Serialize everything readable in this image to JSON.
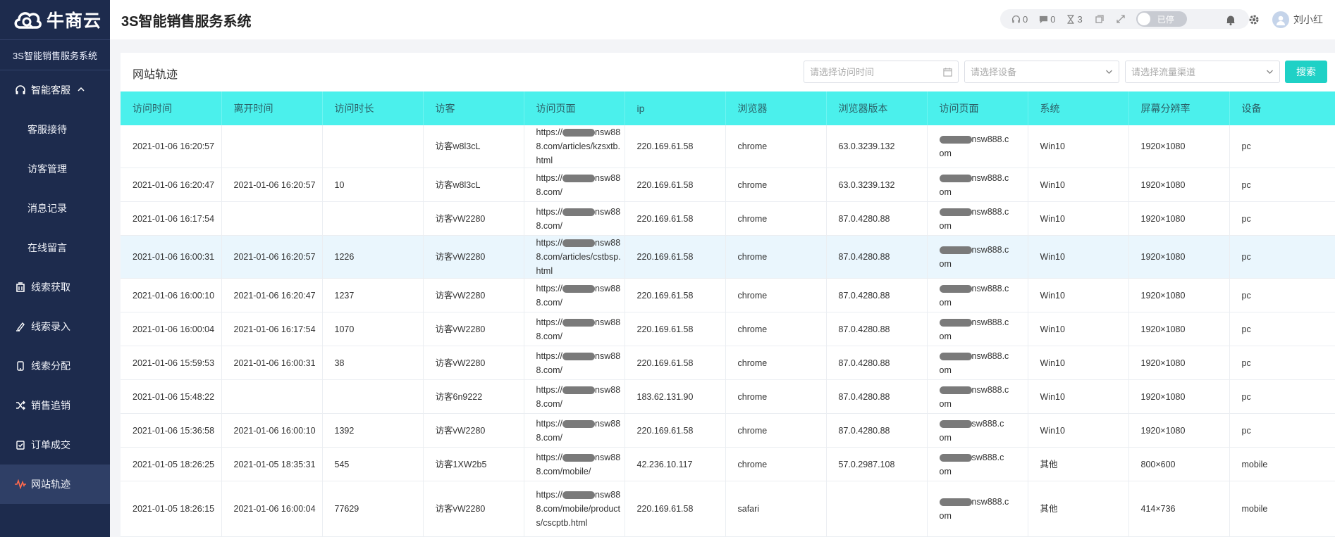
{
  "brand": {
    "logo_text": "牛商云",
    "system_name": "3S智能销售服务系统"
  },
  "sidebar": {
    "group": {
      "label": "智能客服"
    },
    "sub_items": [
      {
        "label": "客服接待"
      },
      {
        "label": "访客管理"
      },
      {
        "label": "消息记录"
      },
      {
        "label": "在线留言"
      }
    ],
    "items": [
      {
        "label": "线索获取",
        "icon": "building-icon"
      },
      {
        "label": "线索录入",
        "icon": "pen-icon"
      },
      {
        "label": "线索分配",
        "icon": "phone-icon"
      },
      {
        "label": "销售追销",
        "icon": "shuffle-icon"
      },
      {
        "label": "订单成交",
        "icon": "clipboard-icon"
      },
      {
        "label": "网站轨迹",
        "icon": "wave-icon",
        "active": true
      }
    ]
  },
  "header": {
    "title": "3S智能销售服务系统",
    "stats": {
      "headset": "0",
      "message": "0",
      "hourglass": "3"
    },
    "toggle_label": "已停",
    "user_name": "刘小红"
  },
  "panel": {
    "title": "网站轨迹",
    "filters": {
      "time_placeholder": "请选择访问时间",
      "device_placeholder": "请选择设备",
      "channel_placeholder": "请选择流量渠道"
    },
    "search_label": "搜索"
  },
  "table": {
    "columns": [
      "访问时间",
      "离开时间",
      "访问时长",
      "访客",
      "访问页面",
      "ip",
      "浏览器",
      "浏览器版本",
      "访问页面",
      "系统",
      "屏幕分辨率",
      "设备"
    ],
    "rows": [
      {
        "visit_time": "2021-01-06 16:20:57",
        "leave_time": "",
        "duration": "",
        "visitor": "访客w8l3cL",
        "page_a": "https://",
        "page_b": "ns",
        "page_c": "w888.com/articles/kzsxtb.html",
        "ip": "220.169.61.58",
        "browser": "chrome",
        "version": "63.0.3239.132",
        "domain_a": "nsw888.c",
        "domain_b": "om",
        "os": "Win10",
        "resolution": "1920×1080",
        "device": "pc"
      },
      {
        "visit_time": "2021-01-06 16:20:47",
        "leave_time": "2021-01-06 16:20:57",
        "duration": "10",
        "visitor": "访客w8l3cL",
        "page_a": "https://",
        "page_b": "ns",
        "page_c": "w888.com/",
        "ip": "220.169.61.58",
        "browser": "chrome",
        "version": "63.0.3239.132",
        "domain_a": "nsw888.c",
        "domain_b": "om",
        "os": "Win10",
        "resolution": "1920×1080",
        "device": "pc"
      },
      {
        "visit_time": "2021-01-06 16:17:54",
        "leave_time": "",
        "duration": "",
        "visitor": "访客vW2280",
        "page_a": "https://",
        "page_b": "ns",
        "page_c": "w888.com/",
        "ip": "220.169.61.58",
        "browser": "chrome",
        "version": "87.0.4280.88",
        "domain_a": "nsw888.c",
        "domain_b": "om",
        "os": "Win10",
        "resolution": "1920×1080",
        "device": "pc"
      },
      {
        "visit_time": "2021-01-06 16:00:31",
        "leave_time": "2021-01-06 16:20:57",
        "duration": "1226",
        "visitor": "访客vW2280",
        "page_a": "https://",
        "page_b": "ns",
        "page_c": "w888.com/articles/cstbsp.html",
        "ip": "220.169.61.58",
        "browser": "chrome",
        "version": "87.0.4280.88",
        "domain_a": "nsw888.c",
        "domain_b": "om",
        "os": "Win10",
        "resolution": "1920×1080",
        "device": "pc"
      },
      {
        "visit_time": "2021-01-06 16:00:10",
        "leave_time": "2021-01-06 16:20:47",
        "duration": "1237",
        "visitor": "访客vW2280",
        "page_a": "https://",
        "page_b": "ns",
        "page_c": "w888.com/",
        "ip": "220.169.61.58",
        "browser": "chrome",
        "version": "87.0.4280.88",
        "domain_a": "nsw888.c",
        "domain_b": "om",
        "os": "Win10",
        "resolution": "1920×1080",
        "device": "pc"
      },
      {
        "visit_time": "2021-01-06 16:00:04",
        "leave_time": "2021-01-06 16:17:54",
        "duration": "1070",
        "visitor": "访客vW2280",
        "page_a": "https://",
        "page_b": "ns",
        "page_c": "w888.com/",
        "ip": "220.169.61.58",
        "browser": "chrome",
        "version": "87.0.4280.88",
        "domain_a": "nsw888.c",
        "domain_b": "om",
        "os": "Win10",
        "resolution": "1920×1080",
        "device": "pc"
      },
      {
        "visit_time": "2021-01-06 15:59:53",
        "leave_time": "2021-01-06 16:00:31",
        "duration": "38",
        "visitor": "访客vW2280",
        "page_a": "https://",
        "page_b": "ns",
        "page_c": "w888.com/",
        "ip": "220.169.61.58",
        "browser": "chrome",
        "version": "87.0.4280.88",
        "domain_a": "nsw888.c",
        "domain_b": "om",
        "os": "Win10",
        "resolution": "1920×1080",
        "device": "pc"
      },
      {
        "visit_time": "2021-01-06 15:48:22",
        "leave_time": "",
        "duration": "",
        "visitor": "访客6n9222",
        "page_a": "https://",
        "page_b": "ns",
        "page_c": "w888.com/",
        "ip": "183.62.131.90",
        "browser": "chrome",
        "version": "87.0.4280.88",
        "domain_a": "nsw888.c",
        "domain_b": "om",
        "os": "Win10",
        "resolution": "1920×1080",
        "device": "pc"
      },
      {
        "visit_time": "2021-01-06 15:36:58",
        "leave_time": "2021-01-06 16:00:10",
        "duration": "1392",
        "visitor": "访客vW2280",
        "page_a": "https://",
        "page_b": "ns",
        "page_c": "w888.com/",
        "ip": "220.169.61.58",
        "browser": "chrome",
        "version": "87.0.4280.88",
        "domain_a": "sw888.c",
        "domain_b": "om",
        "os": "Win10",
        "resolution": "1920×1080",
        "device": "pc"
      },
      {
        "visit_time": "2021-01-05 18:26:25",
        "leave_time": "2021-01-05 18:35:31",
        "duration": "545",
        "visitor": "访客1XW2b5",
        "page_a": "https://",
        "page_b": "ns",
        "page_c": "w888.com/mobile/",
        "ip": "42.236.10.117",
        "browser": "chrome",
        "version": "57.0.2987.108",
        "domain_a": "sw888.c",
        "domain_b": "om",
        "os": "其他",
        "resolution": "800×600",
        "device": "mobile"
      },
      {
        "visit_time": "2021-01-05 18:26:15",
        "leave_time": "2021-01-06 16:00:04",
        "duration": "77629",
        "visitor": "访客vW2280",
        "page_a": "https://",
        "page_b": "ns",
        "page_c": "w888.com/mobile/products/cscptb.html",
        "ip": "220.169.61.58",
        "browser": "safari",
        "version": "",
        "domain_a": "nsw888.c",
        "domain_b": "om",
        "os": "其他",
        "resolution": "414×736",
        "device": "mobile"
      }
    ]
  }
}
